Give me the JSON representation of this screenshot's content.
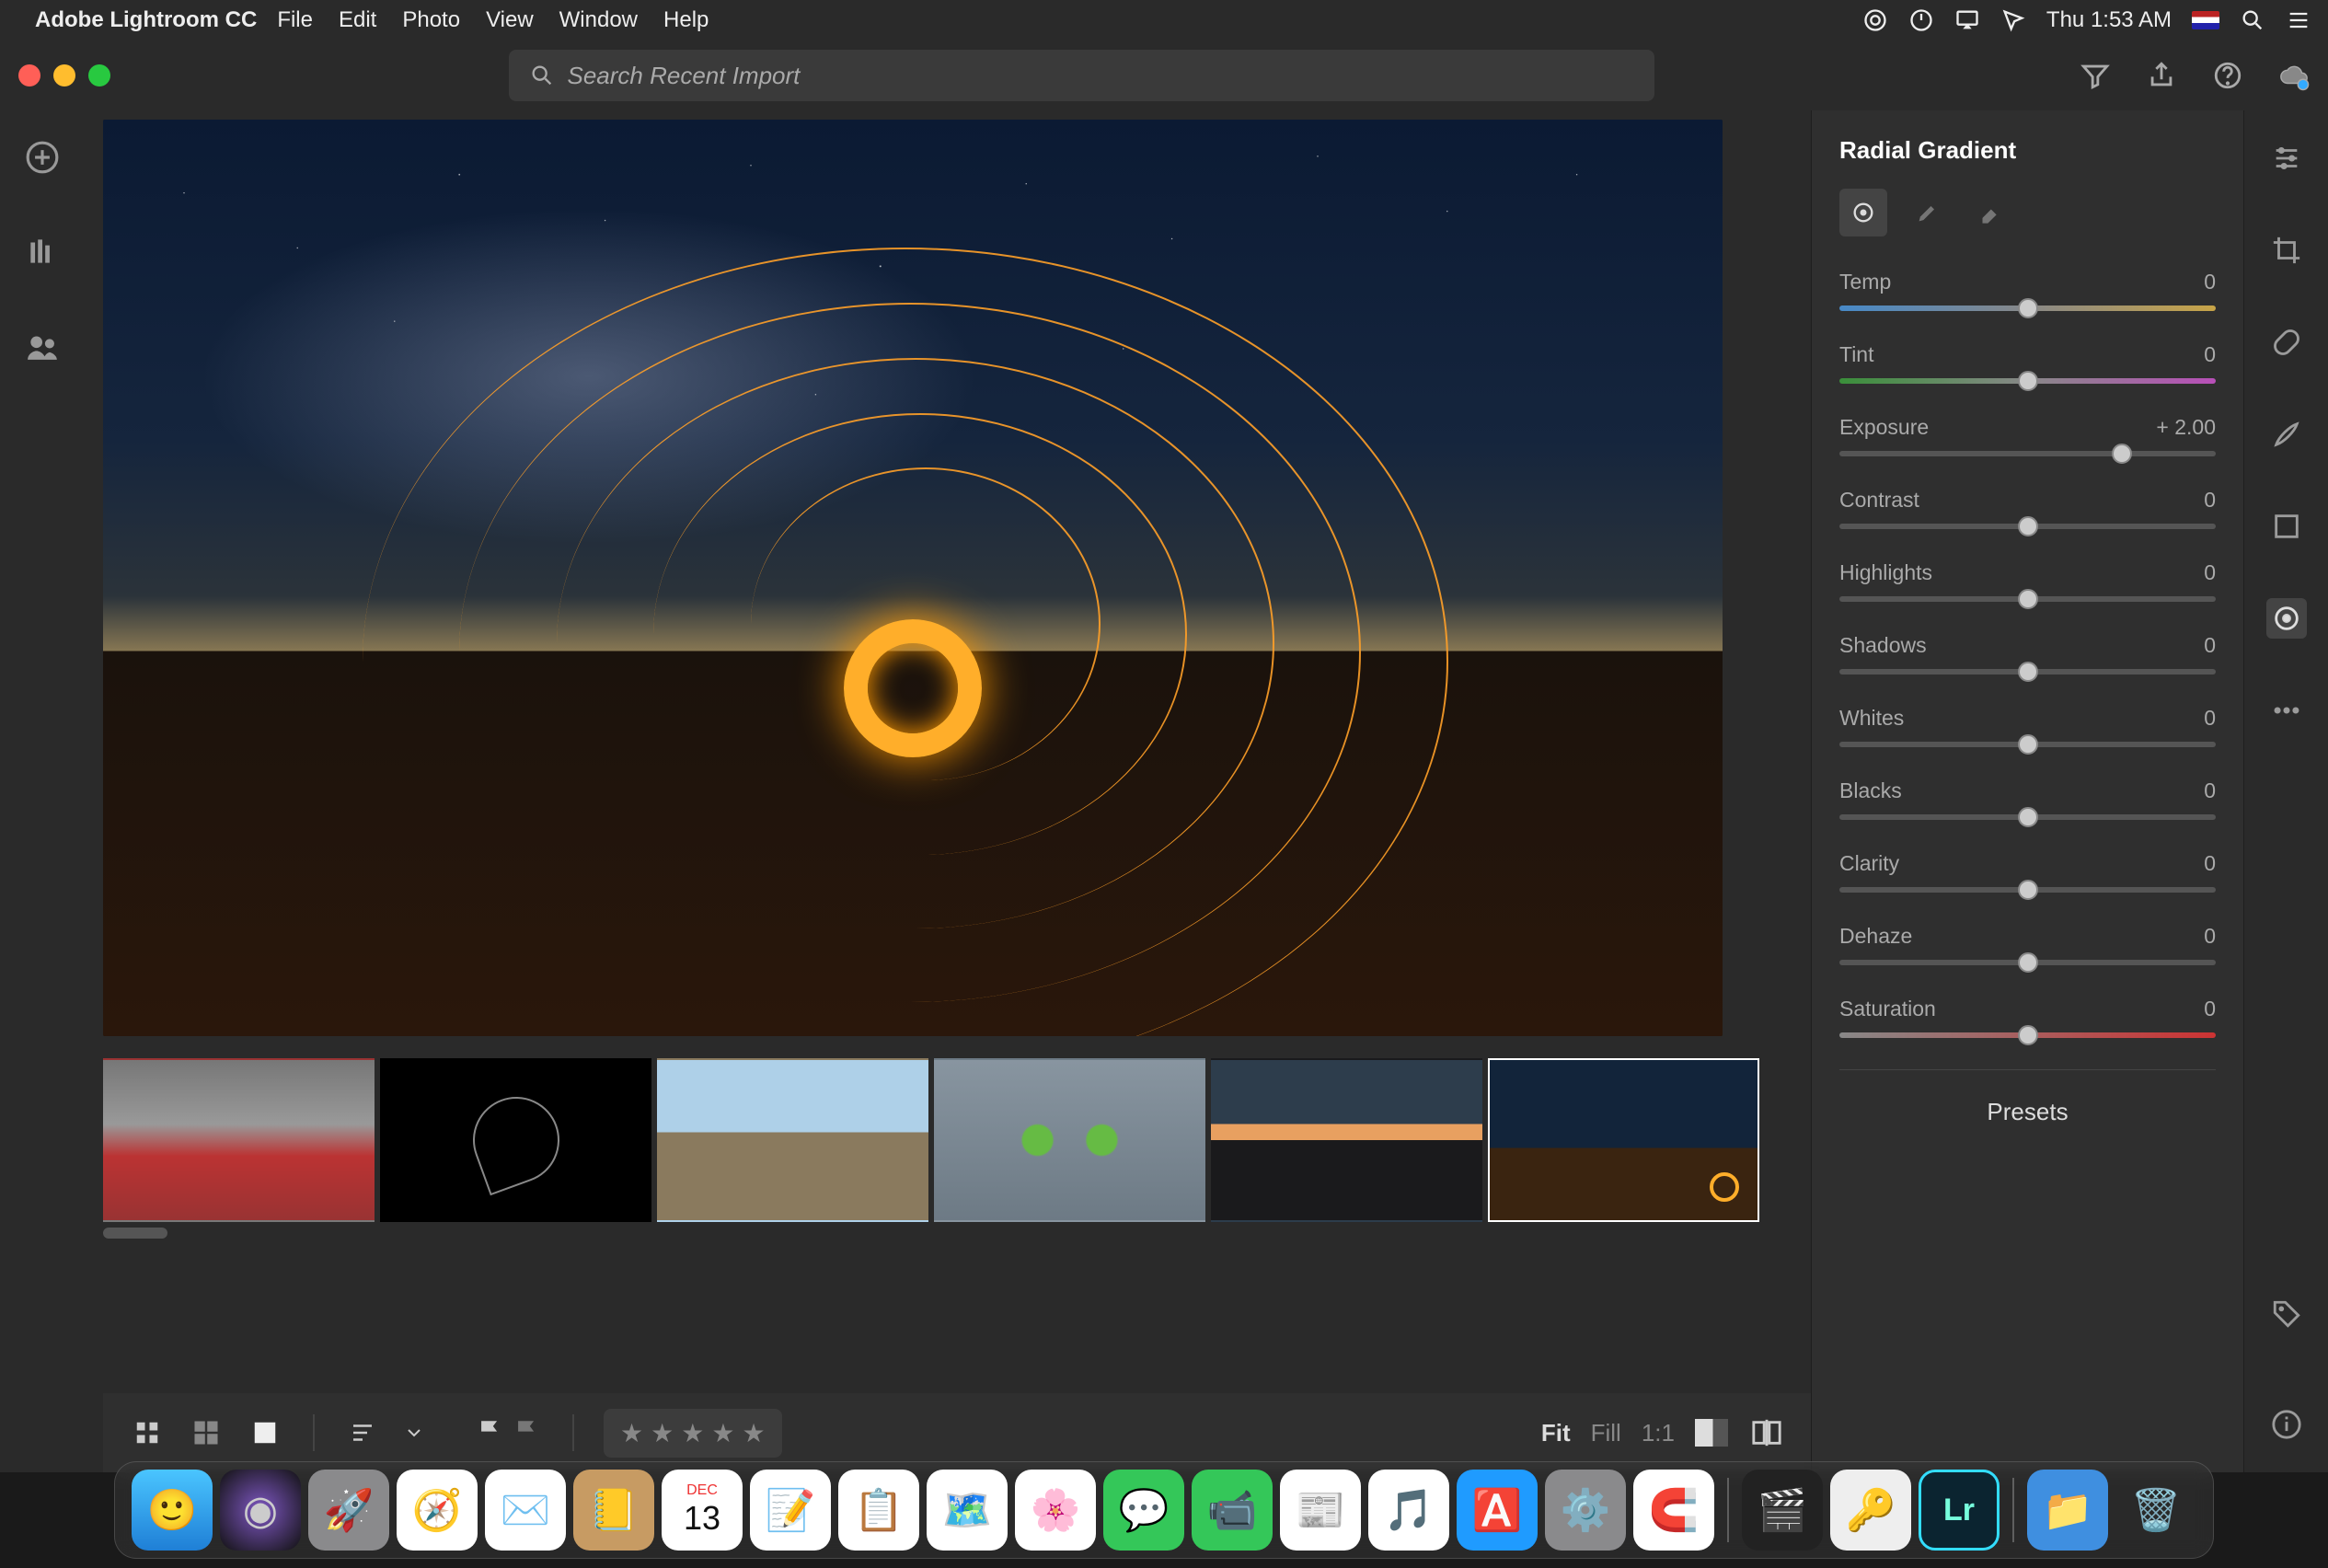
{
  "menubar": {
    "app_name": "Adobe Lightroom CC",
    "items": [
      "File",
      "Edit",
      "Photo",
      "View",
      "Window",
      "Help"
    ],
    "clock": "Thu 1:53 AM"
  },
  "chrome": {
    "search_placeholder": "Search Recent Import"
  },
  "panel": {
    "title": "Radial Gradient",
    "sliders": [
      {
        "label": "Temp",
        "value": "0",
        "pos": 50,
        "cls": "temp"
      },
      {
        "label": "Tint",
        "value": "0",
        "pos": 50,
        "cls": "tint"
      },
      {
        "label": "Exposure",
        "value": "+ 2.00",
        "pos": 75,
        "cls": ""
      },
      {
        "label": "Contrast",
        "value": "0",
        "pos": 50,
        "cls": ""
      },
      {
        "label": "Highlights",
        "value": "0",
        "pos": 50,
        "cls": ""
      },
      {
        "label": "Shadows",
        "value": "0",
        "pos": 50,
        "cls": ""
      },
      {
        "label": "Whites",
        "value": "0",
        "pos": 50,
        "cls": ""
      },
      {
        "label": "Blacks",
        "value": "0",
        "pos": 50,
        "cls": ""
      },
      {
        "label": "Clarity",
        "value": "0",
        "pos": 50,
        "cls": ""
      },
      {
        "label": "Dehaze",
        "value": "0",
        "pos": 50,
        "cls": ""
      },
      {
        "label": "Saturation",
        "value": "0",
        "pos": 50,
        "cls": "sat"
      }
    ],
    "presets_label": "Presets"
  },
  "bottombar": {
    "fit": "Fit",
    "fill": "Fill",
    "ratio": "1:1"
  },
  "dock_icons": [
    "finder",
    "siri",
    "launchpad",
    "safari",
    "mail",
    "contacts",
    "calendar",
    "notes",
    "reminders",
    "maps",
    "photos",
    "messages",
    "facetime",
    "news",
    "itunes",
    "appstore",
    "settings",
    "magnet",
    "imovie",
    "1password",
    "lightroom",
    "downloads",
    "trash"
  ],
  "calendar_day": "13"
}
